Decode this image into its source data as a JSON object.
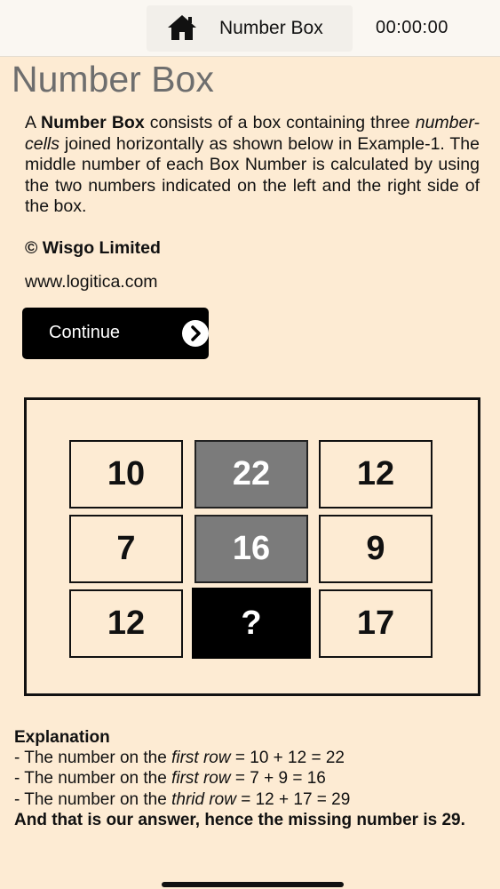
{
  "topbar": {
    "title": "Number Box",
    "timer": "00:00:00",
    "home_icon": "home-icon"
  },
  "page": {
    "title": "Number Box"
  },
  "intro": {
    "p1": "A ",
    "bold1": "Number Box",
    "p2": " consists of a box containing three ",
    "ital1": "number-cells",
    "p3": " joined horizontally as shown below in Example-1. The middle number of each Box Number is calculated by using the two numbers indicated on the left and the right side of the box."
  },
  "copyright": "© Wisgo Limited",
  "website": "www.logitica.com",
  "continue_button": {
    "label": "Continue",
    "icon": "chevron-right-circle-icon"
  },
  "puzzle": {
    "rows": [
      [
        "10",
        "22",
        "12"
      ],
      [
        "7",
        "16",
        "9"
      ],
      [
        "12",
        "?",
        "17"
      ]
    ]
  },
  "explanation": {
    "heading": "Explanation",
    "line1_a": "- The number on the ",
    "line1_i": "first row",
    "line1_b": " = 10 + 12 = 22",
    "line2_a": "- The number on the ",
    "line2_i": "first row",
    "line2_b": " = 7 + 9 = 16",
    "line3_a": "- The number on the ",
    "line3_i": "thrid row",
    "line3_b": " = 12 + 17 = 29",
    "conclusion": "And that is our answer, hence the missing number is 29."
  },
  "colors": {
    "background": "#fdebd3",
    "topbar": "#faf7f2",
    "middle_cell": "#7b7b7b",
    "answer_cell": "#000000",
    "button": "#000000"
  }
}
